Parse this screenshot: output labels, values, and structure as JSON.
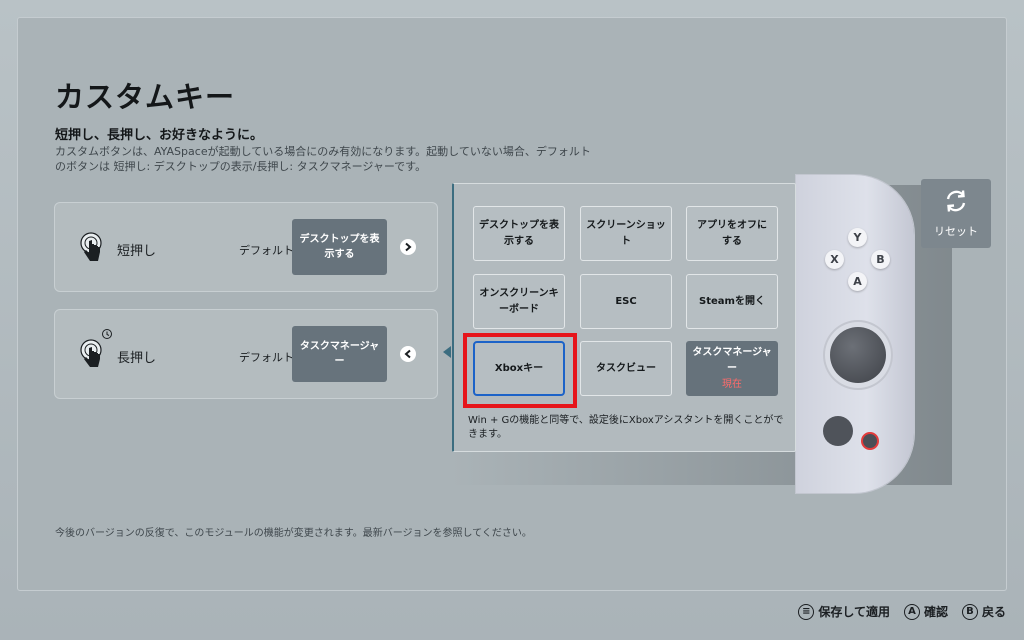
{
  "page": {
    "title": "カスタムキー",
    "subtitle": "短押し、長押し、お好きなように。",
    "description": "カスタムボタンは、AYASpaceが起動している場合にのみ有効になります。起動していない場合、デフォルトのボタンは 短押し: デスクトップの表示/長押し: タスクマネージャーです。",
    "footer_note": "今後のバージョンの反復で、このモジュールの機能が変更されます。最新バージョンを参照してください。"
  },
  "rows": {
    "short_press": {
      "label": "短押し",
      "default_label": "デフォルト",
      "value": "デスクトップを表示する",
      "arrow": "chevron-right-icon"
    },
    "long_press": {
      "label": "長押し",
      "default_label": "デフォルト",
      "value": "タスクマネージャー",
      "arrow": "chevron-left-icon"
    }
  },
  "options": [
    {
      "label": "デスクトップを表示する",
      "state": "normal"
    },
    {
      "label": "スクリーンショット",
      "state": "normal"
    },
    {
      "label": "アプリをオフにする",
      "state": "normal"
    },
    {
      "label": "オンスクリーンキーボード",
      "state": "normal"
    },
    {
      "label": "ESC",
      "state": "normal"
    },
    {
      "label": "Steamを開く",
      "state": "normal"
    },
    {
      "label": "Xboxキー",
      "state": "selected"
    },
    {
      "label": "タスクビュー",
      "state": "normal"
    },
    {
      "label": "タスクマネージャー",
      "state": "current",
      "current_label": "現在"
    }
  ],
  "help_text": "Win + Gの機能と同等で、設定後にXboxアシスタントを開くことができます。",
  "controller": {
    "buttons": [
      "Y",
      "X",
      "B",
      "A"
    ]
  },
  "reset": {
    "label": "リセット",
    "icon": "refresh-icon"
  },
  "hints": [
    {
      "glyph": "≡",
      "label": "保存して適用"
    },
    {
      "glyph": "A",
      "label": "確認"
    },
    {
      "glyph": "B",
      "label": "戻る"
    }
  ],
  "colors": {
    "accent_blue": "#1c63c8",
    "highlight_red": "#e6151b",
    "current_text": "#ff6b6b",
    "dark_button": "#66727b"
  }
}
